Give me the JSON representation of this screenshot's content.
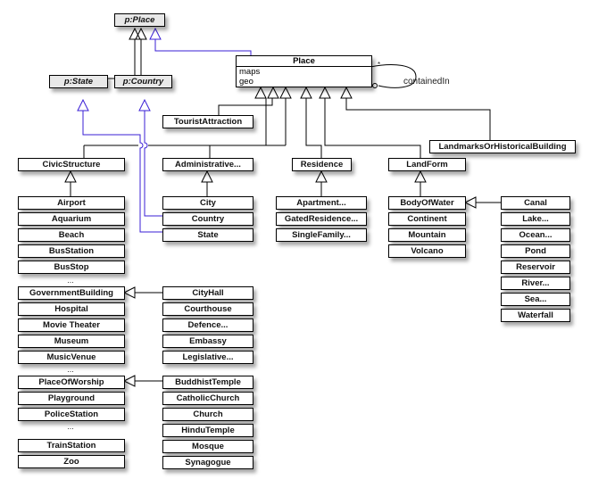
{
  "external": {
    "place": "p:Place",
    "state": "p:State",
    "country": "p:Country"
  },
  "place": {
    "name": "Place",
    "attributes": [
      "maps",
      "geo"
    ],
    "association": "containedIn",
    "multiplicity": "*"
  },
  "direct_subclasses": {
    "tourist": "TouristAttraction",
    "landmarks": "LandmarksOrHistoricalBuilding",
    "civic": "CivicStructure",
    "administrative": "Administrative...",
    "residence": "Residence",
    "landform": "LandForm"
  },
  "civic_items": [
    "Airport",
    "Aquarium",
    "Beach",
    "BusStation",
    "BusStop",
    "...",
    "GovernmentBuilding",
    "Hospital",
    "Movie Theater",
    "Museum",
    "MusicVenue",
    "...",
    "PlaceOfWorship",
    "Playground",
    "PoliceStation",
    "...",
    "TrainStation",
    "Zoo"
  ],
  "administrative_items": [
    "City",
    "Country",
    "State"
  ],
  "government_items": [
    "CityHall",
    "Courthouse",
    "Defence...",
    "Embassy",
    "Legislative..."
  ],
  "worship_items": [
    "BuddhistTemple",
    "CatholicChurch",
    "Church",
    "HinduTemple",
    "Mosque",
    "Synagogue"
  ],
  "residence_items": [
    "Apartment...",
    "GatedResidence...",
    "SingleFamily..."
  ],
  "landform_items": [
    "BodyOfWater",
    "Continent",
    "Mountain",
    "Volcano"
  ],
  "water_items": [
    "Canal",
    "Lake...",
    "Ocean...",
    "Pond",
    "Reservoir",
    "River...",
    "Sea...",
    "Waterfall"
  ],
  "colors": {
    "inheritance": "#000000",
    "external_link": "#3a1fd6",
    "external_fill": "#e8e8e8"
  }
}
